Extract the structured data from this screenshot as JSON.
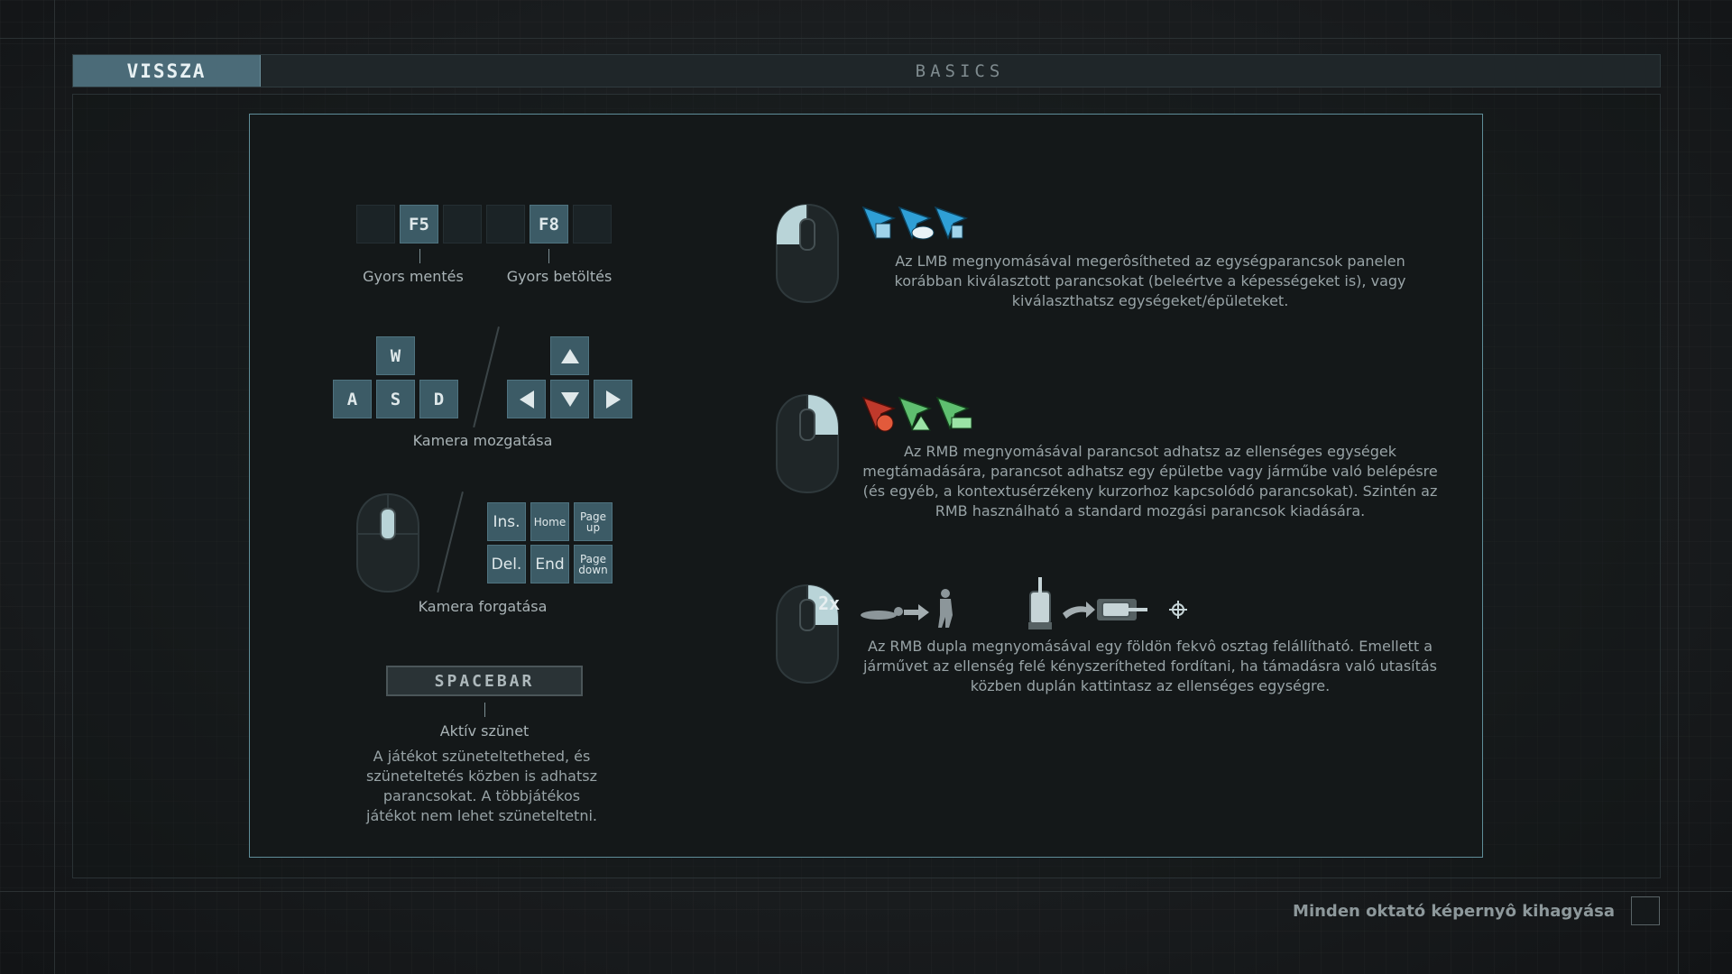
{
  "header": {
    "back_label": "VISSZA",
    "title": "BASICS"
  },
  "quick": {
    "f5": "F5",
    "f8": "F8",
    "save_label": "Gyors mentés",
    "load_label": "Gyors betöltés"
  },
  "camera_move": {
    "w": "W",
    "a": "A",
    "s": "S",
    "d": "D",
    "label": "Kamera mozgatása"
  },
  "camera_rotate": {
    "ins": "Ins.",
    "home": "Home",
    "pageup": "Page up",
    "del": "Del.",
    "end": "End",
    "pagedown": "Page down",
    "label": "Kamera forgatása"
  },
  "pause": {
    "key": "SPACEBAR",
    "label": "Aktív szünet",
    "desc": "A játékot szüneteltetheted, és szüneteltetés közben is adhatsz parancsokat. A többjátékos játékot nem lehet szüneteltetni."
  },
  "lmb": {
    "desc": "Az LMB megnyomásával megerôsítheted az egységparancsok panelen korábban kiválasztott parancsokat (beleértve a képességeket is), vagy kiválaszthatsz egységeket/épületeket."
  },
  "rmb": {
    "desc": "Az RMB megnyomásával parancsot adhatsz az ellenséges egységek megtámadására, parancsot adhatsz egy épületbe vagy járműbe való belépésre (és egyéb, a kontextusérzékeny kurzorhoz kapcsolódó parancsokat). Szintén az RMB használható a standard mozgási parancsok kiadására."
  },
  "rmb_double": {
    "badge": "2x",
    "desc": "Az RMB dupla megnyomásával egy földön fekvô osztag felállítható. Emellett a járművet az ellenség felé kényszerítheted fordítani, ha támadásra való utasítás közben duplán kattintasz az ellenséges egységre."
  },
  "footer": {
    "skip_label": "Minden oktató képernyô kihagyása"
  },
  "colors": {
    "accent": "#4b6b78",
    "panel_border": "#5f8d99",
    "cursor_blue": "#2f9fd6",
    "cursor_red": "#c0392b",
    "cursor_green": "#5fbf70"
  }
}
